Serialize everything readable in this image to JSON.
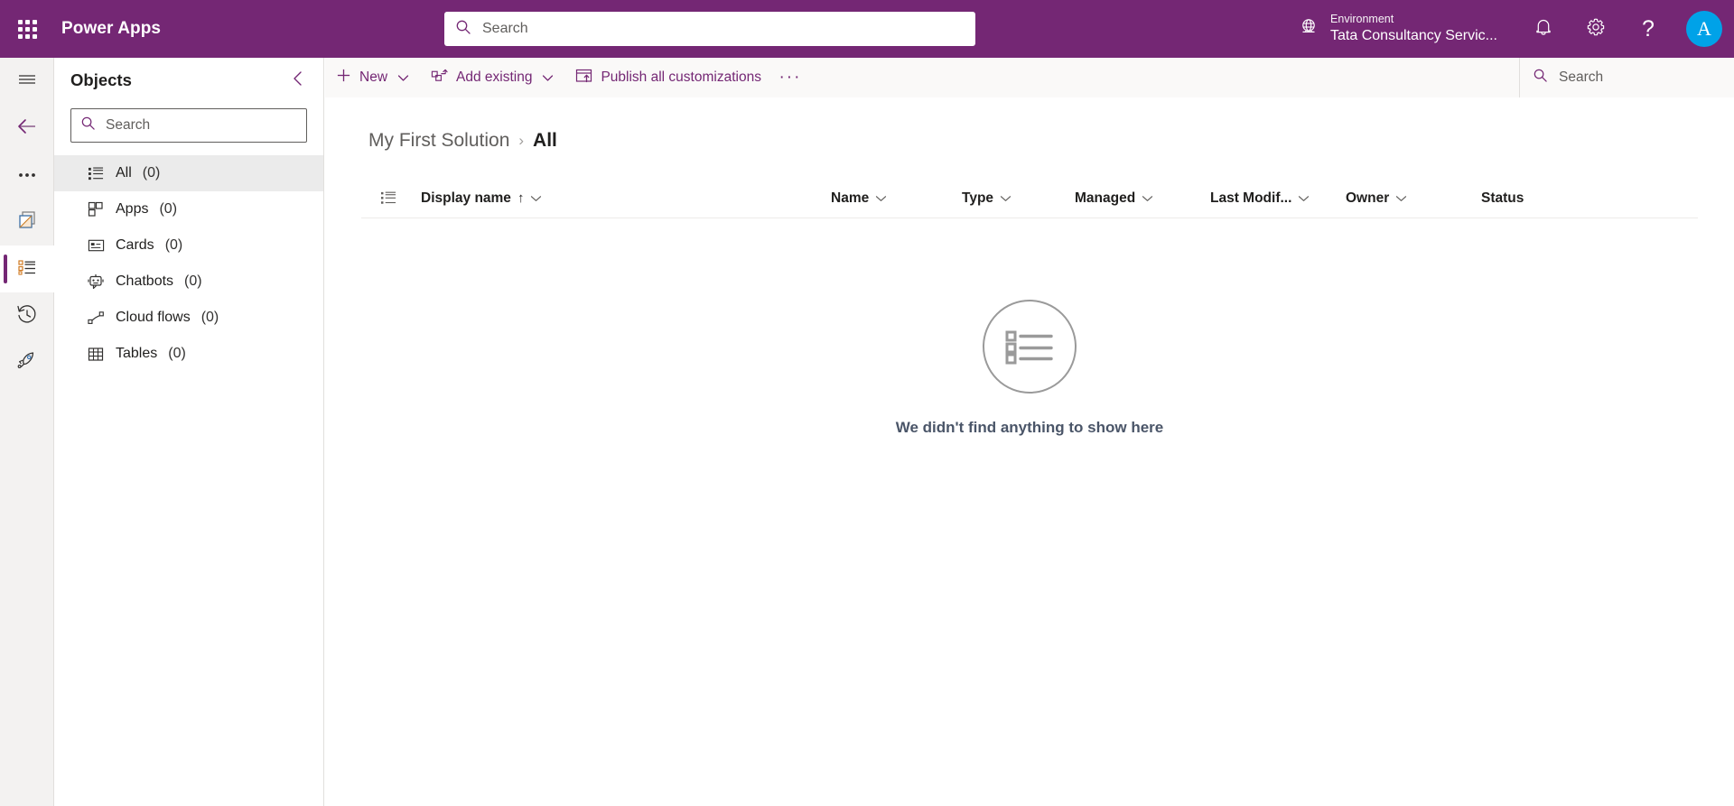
{
  "header": {
    "brand": "Power Apps",
    "waffle_icon": "waffle-grid-icon",
    "search": {
      "placeholder": "Search",
      "value": "",
      "icon": "search-icon"
    },
    "environment": {
      "icon": "globe-icon",
      "label": "Environment",
      "name": "Tata Consultancy Servic..."
    },
    "icons": [
      {
        "name": "notifications-icon",
        "glyph": "bell"
      },
      {
        "name": "settings-gear-icon",
        "glyph": "gear"
      },
      {
        "name": "help-icon",
        "glyph": "?"
      }
    ],
    "avatar": {
      "initial": "A",
      "color": "#00a2e8"
    }
  },
  "rail": {
    "items": [
      {
        "name": "hamburger-menu-icon",
        "glyph": "hamburger",
        "selected": false
      },
      {
        "name": "back-arrow-icon",
        "glyph": "back",
        "selected": false
      },
      {
        "name": "more-options-icon",
        "glyph": "ellipsis",
        "selected": false
      },
      {
        "name": "solutions-icon",
        "glyph": "solutions",
        "selected": false
      },
      {
        "name": "objects-list-icon",
        "glyph": "objects",
        "selected": true
      },
      {
        "name": "history-icon",
        "glyph": "history",
        "selected": false
      },
      {
        "name": "rocket-icon",
        "glyph": "rocket",
        "selected": false
      }
    ]
  },
  "objects_panel": {
    "title": "Objects",
    "collapse_icon": "chevron-left-icon",
    "search": {
      "placeholder": "Search",
      "value": "",
      "icon": "search-icon"
    },
    "items": [
      {
        "label": "All",
        "count": "(0)",
        "icon": "list-icon",
        "selected": true
      },
      {
        "label": "Apps",
        "count": "(0)",
        "icon": "apps-icon",
        "selected": false
      },
      {
        "label": "Cards",
        "count": "(0)",
        "icon": "card-icon",
        "selected": false
      },
      {
        "label": "Chatbots",
        "count": "(0)",
        "icon": "chatbot-icon",
        "selected": false
      },
      {
        "label": "Cloud flows",
        "count": "(0)",
        "icon": "cloud-flow-icon",
        "selected": false
      },
      {
        "label": "Tables",
        "count": "(0)",
        "icon": "table-icon",
        "selected": false
      }
    ]
  },
  "command_bar": {
    "new_label": "New",
    "add_existing_label": "Add existing",
    "publish_label": "Publish all customizations",
    "overflow_label": "···",
    "search": {
      "placeholder": "Search",
      "value": "",
      "icon": "search-icon"
    }
  },
  "breadcrumb": {
    "root": "My First Solution",
    "separator": "›",
    "current": "All"
  },
  "grid": {
    "row_icon": "list-view-icon",
    "columns": [
      {
        "label": "Display name",
        "sorted": true,
        "sort_arrow": "↑",
        "has_menu": true
      },
      {
        "label": "Name",
        "sorted": false,
        "sort_arrow": "",
        "has_menu": true
      },
      {
        "label": "Type",
        "sorted": false,
        "sort_arrow": "",
        "has_menu": true
      },
      {
        "label": "Managed",
        "sorted": false,
        "sort_arrow": "",
        "has_menu": true
      },
      {
        "label": "Last Modif...",
        "sorted": false,
        "sort_arrow": "",
        "has_menu": true
      },
      {
        "label": "Owner",
        "sorted": false,
        "sort_arrow": "",
        "has_menu": true
      },
      {
        "label": "Status",
        "sorted": false,
        "sort_arrow": "",
        "has_menu": false
      }
    ],
    "rows": [],
    "empty_state": {
      "icon": "empty-list-illustration",
      "message": "We didn't find anything to show here"
    }
  },
  "theme": {
    "brand_purple": "#742774",
    "command_text": "#742774",
    "panel_bg": "#f3f2f1",
    "selected_bg": "#ebebeb",
    "accent_blue": "#00a2e8"
  }
}
